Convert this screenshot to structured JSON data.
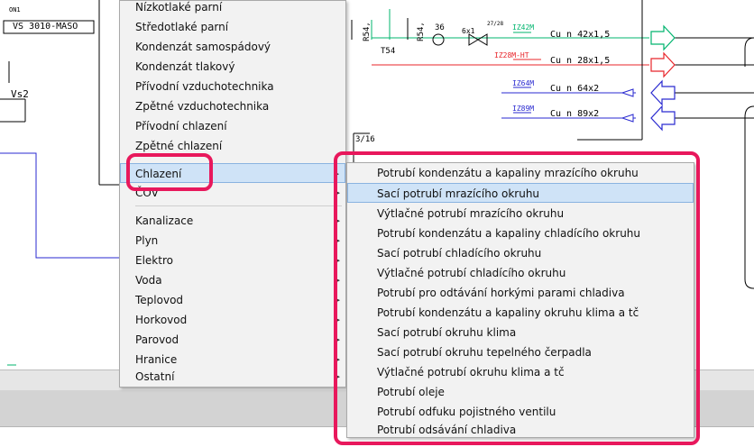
{
  "cad": {
    "block_label": "VS 3010-MASO",
    "cut_label": "ON1",
    "vs_label": "Vs2",
    "pipe_labels": {
      "r54_a": "R54,",
      "r54_b": "R54,",
      "t54": "T54",
      "num_36": "36",
      "sixx1": "6x1",
      "ratio": "27/28",
      "tag_3_16": "3/16"
    },
    "pipes": [
      {
        "tag": "IZ42M",
        "spec": "Cu n 42x1,5",
        "color": "#00b46e"
      },
      {
        "tag": "IZ28M-HT",
        "spec": "Cu n 28x1,5",
        "color": "#e8252a"
      },
      {
        "tag": "IZ64M",
        "spec": "Cu n 64x2",
        "color": "#2a2ad0"
      },
      {
        "tag": "IZ89M",
        "spec": "Cu n 89x2",
        "color": "#2a2ad0"
      }
    ]
  },
  "menu": {
    "items": [
      {
        "label": "Nízkotlaké parní",
        "submenu": false
      },
      {
        "label": "Středotlaké parní",
        "submenu": false
      },
      {
        "label": "Kondenzát samospádový",
        "submenu": false
      },
      {
        "label": "Kondenzát tlakový",
        "submenu": false
      },
      {
        "label": "Přívodní vzduchotechnika",
        "submenu": false
      },
      {
        "label": "Zpětné vzduchotechnika",
        "submenu": false
      },
      {
        "label": "Přívodní chlazení",
        "submenu": false
      },
      {
        "label": "Zpětné chlazení",
        "submenu": false
      },
      {
        "label": "Chlazení",
        "submenu": true,
        "highlighted": true
      },
      {
        "label": "ČOV",
        "submenu": true
      },
      {
        "label": "Kanalizace",
        "submenu": true
      },
      {
        "label": "Plyn",
        "submenu": true
      },
      {
        "label": "Elektro",
        "submenu": true
      },
      {
        "label": "Voda",
        "submenu": true
      },
      {
        "label": "Teplovod",
        "submenu": true
      },
      {
        "label": "Horkovod",
        "submenu": true
      },
      {
        "label": "Parovod",
        "submenu": true
      },
      {
        "label": "Hranice",
        "submenu": true
      },
      {
        "label": "Ostatní",
        "submenu": true
      }
    ],
    "submenu_arrow": "▸"
  },
  "submenu": {
    "items": [
      "Potrubí kondenzátu a kapaliny mrazícího okruhu",
      "Sací potrubí mrazícího okruhu",
      "Výtlačné potrubí mrazícího okruhu",
      "Potrubí kondenzátu a kapaliny chladícího okruhu",
      "Sací potrubí chladícího okruhu",
      "Výtlačné potrubí chladícího okruhu",
      "Potrubí pro odtávání horkými parami chladiva",
      "Potrubí kondenzátu a kapaliny okruhu klima a tč",
      "Sací potrubí okruhu klima",
      "Sací potrubí okruhu tepelného čerpadla",
      "Výtlačné potrubí okruhu klima a tč",
      "Potrubí oleje",
      "Potrubí odfuku pojistného ventilu",
      "Potrubí odsávání chladiva"
    ],
    "highlighted_index": 1
  },
  "colors": {
    "callout": "#e8185c",
    "highlight": "#cfe3f7"
  }
}
